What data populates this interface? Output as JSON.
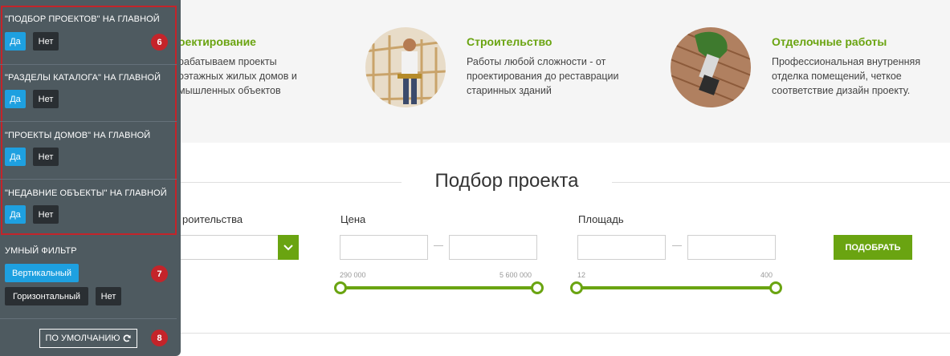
{
  "services": [
    {
      "title": "оектирование",
      "desc": "рабатываем проекты\nоэтажных жилых домов и\nмышленных объектов",
      "icon": "design-photo"
    },
    {
      "title": "Строительство",
      "desc": "Работы любой сложности - от\nпроектирования до реставрации\nстаринных зданий",
      "icon": "builder-photo"
    },
    {
      "title": "Отделочные работы",
      "desc": "Профессиональная внутренняя\nотделка помещений, четкое\nсоответствие дизайн проекту.",
      "icon": "paint-brush-photo"
    }
  ],
  "section_title": "Подбор проекта",
  "filter": {
    "type_label": "роительства",
    "price_label": "Цена",
    "price_min": "290 000",
    "price_max": "5 600 000",
    "area_label": "Площадь",
    "area_min": "12",
    "area_max": "400",
    "submit_label": "ПОДОБРАТЬ",
    "accent": "#6aa411"
  },
  "panel": {
    "options": [
      {
        "title": "\"ПОДБОР ПРОЕКТОВ\" НА ГЛАВНОЙ",
        "yes": "Да",
        "no": "Нет",
        "selected": "yes"
      },
      {
        "title": "\"РАЗДЕЛЫ КАТАЛОГА\" НА ГЛАВНОЙ",
        "yes": "Да",
        "no": "Нет",
        "selected": "yes"
      },
      {
        "title": "\"ПРОЕКТЫ ДОМОВ\" НА ГЛАВНОЙ",
        "yes": "Да",
        "no": "Нет",
        "selected": "yes"
      },
      {
        "title": "\"НЕДАВНИЕ ОБЪЕКТЫ\" НА ГЛАВНОЙ",
        "yes": "Да",
        "no": "Нет",
        "selected": "yes"
      }
    ],
    "smart_filter": {
      "title": "УМНЫЙ ФИЛЬТР",
      "vertical": "Вертикальный",
      "horizontal": "Горизонтальный",
      "none": "Нет",
      "selected": "vertical"
    },
    "reset_label": "ПО УМОЛЧАНИЮ",
    "badges": [
      "6",
      "7",
      "8"
    ],
    "highlight_color": "#c4242a",
    "active_color": "#1ea0e0"
  }
}
